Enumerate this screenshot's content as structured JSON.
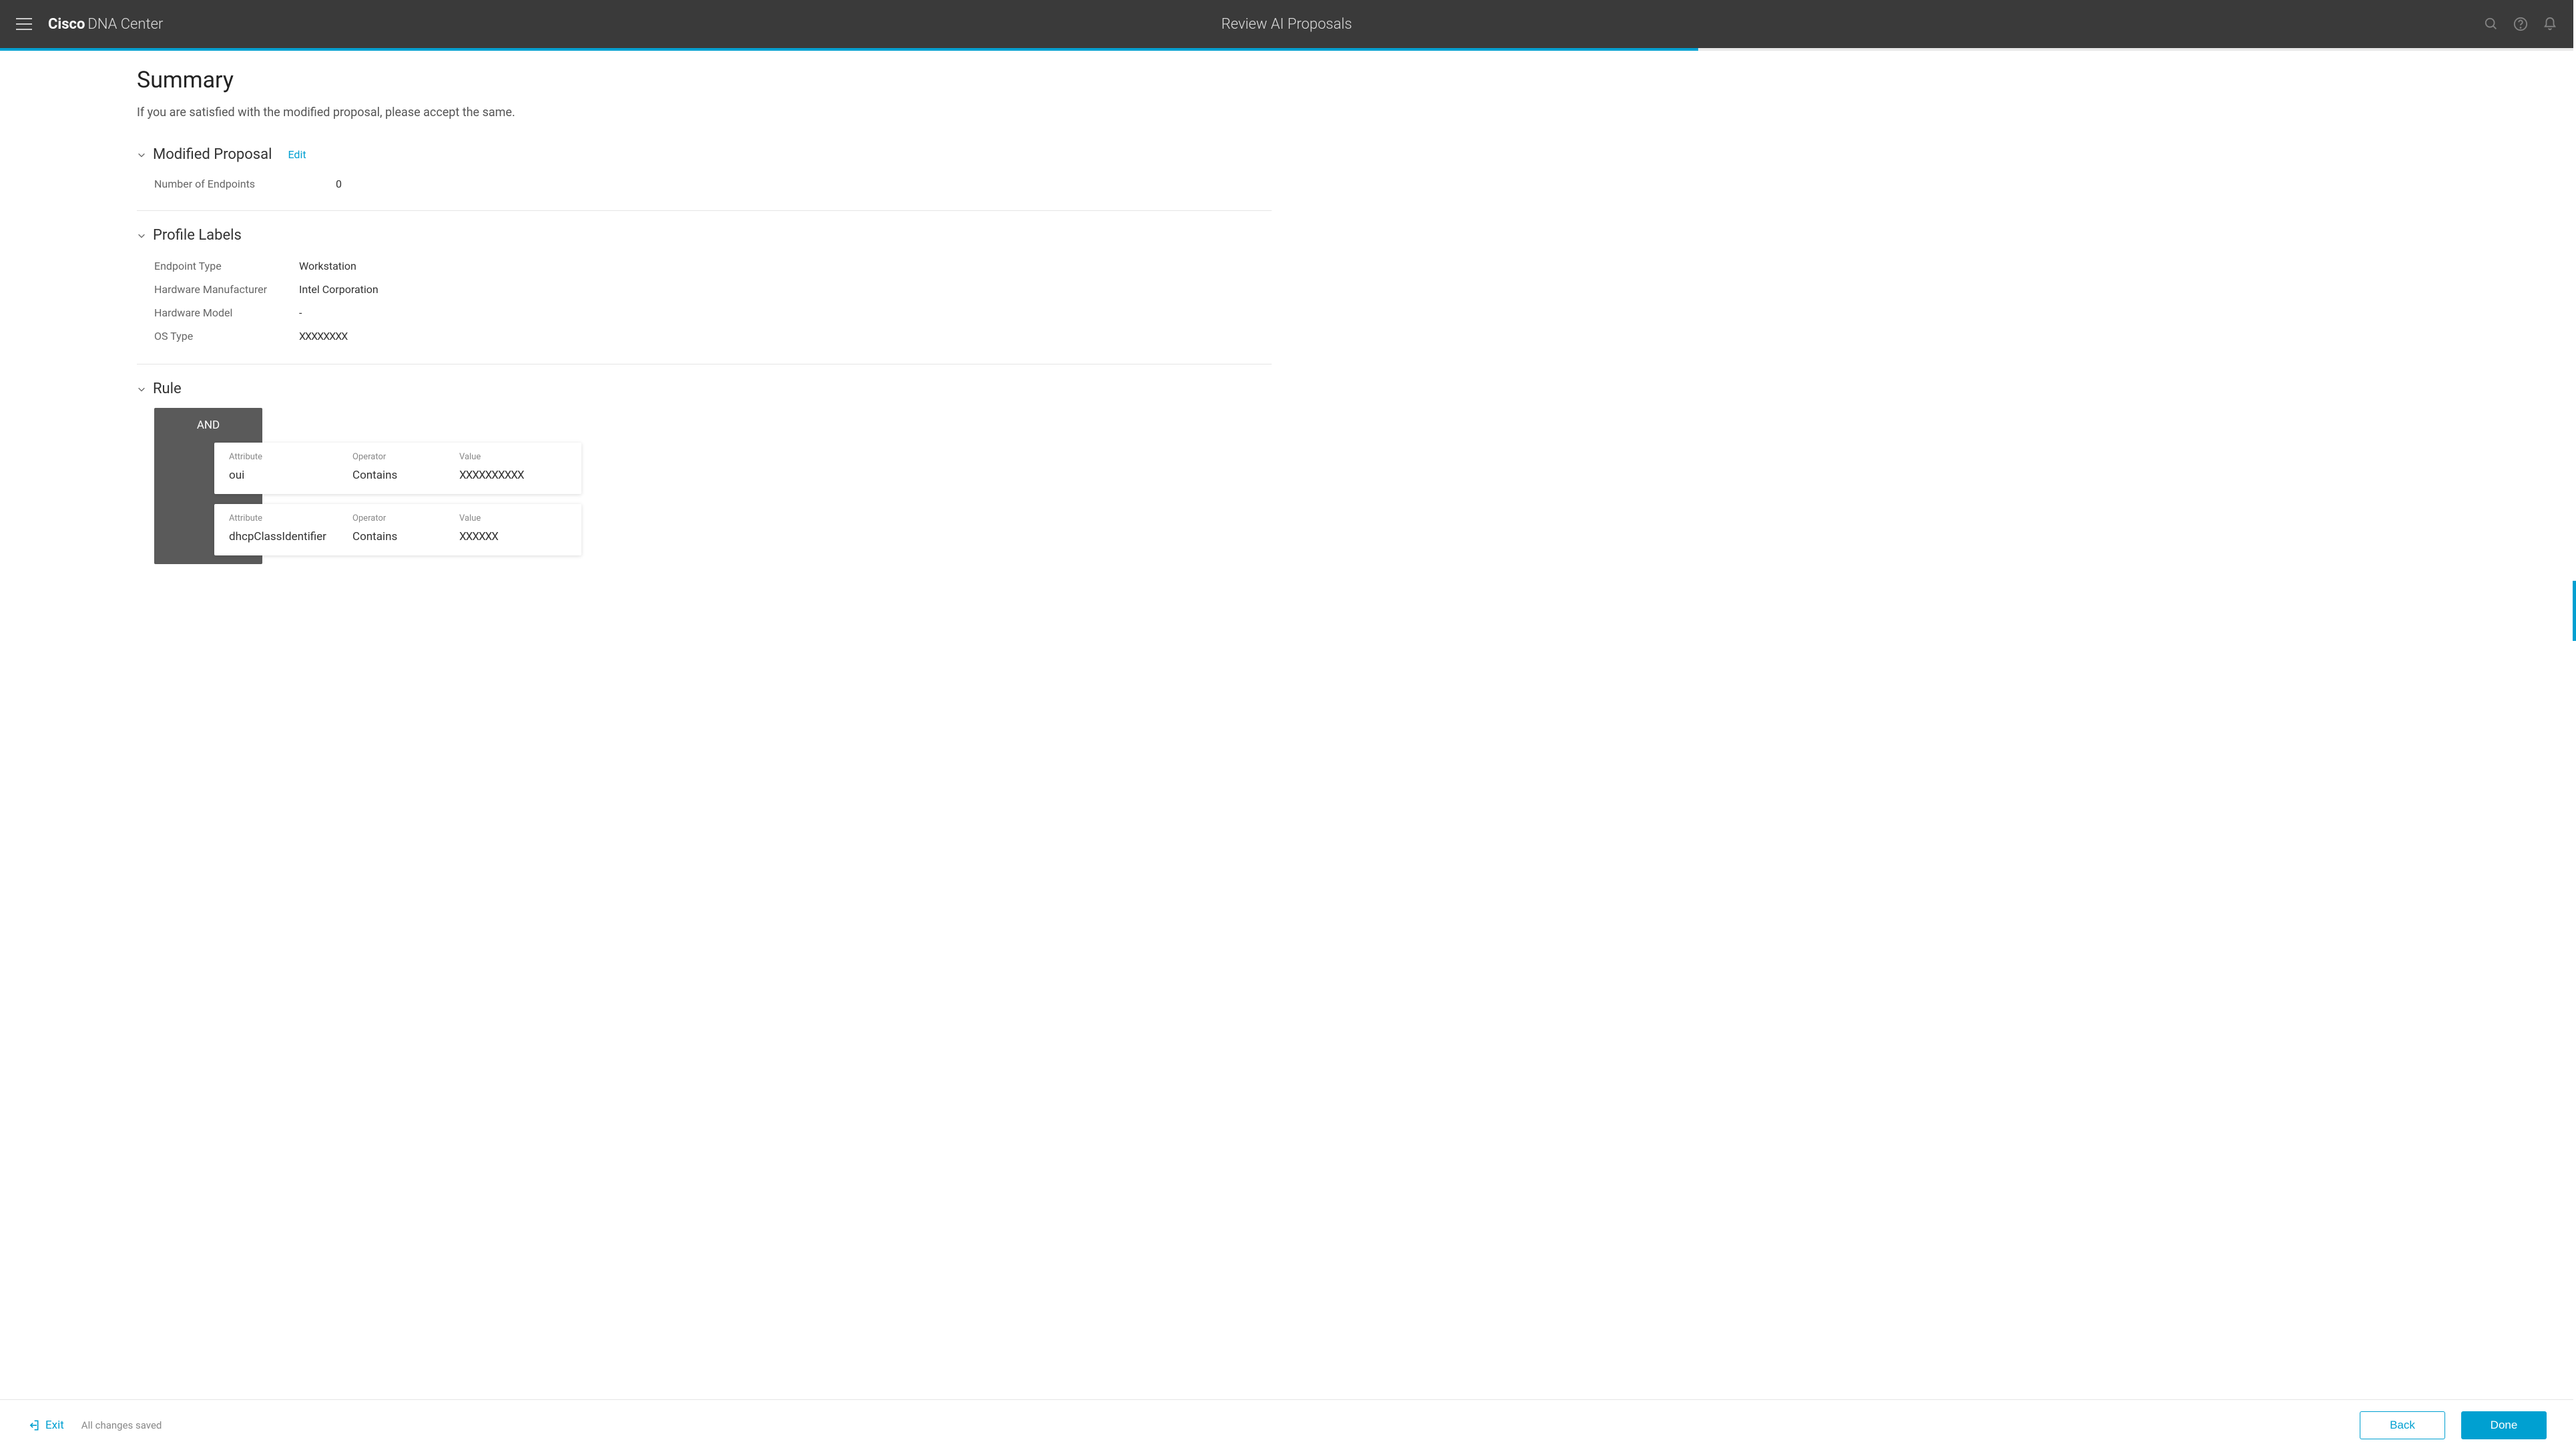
{
  "header": {
    "brand_strong": "Cisco",
    "brand_light": "DNA Center",
    "page_title": "Review AI Proposals"
  },
  "summary": {
    "title": "Summary",
    "subtitle": "If you are satisfied with the modified proposal, please accept the same."
  },
  "modified_proposal": {
    "section_title": "Modified Proposal",
    "edit_label": "Edit",
    "endpoints_label": "Number of Endpoints",
    "endpoints_value": "0"
  },
  "profile_labels": {
    "section_title": "Profile Labels",
    "rows": [
      {
        "label": "Endpoint Type",
        "value": "Workstation"
      },
      {
        "label": "Hardware Manufacturer",
        "value": "Intel Corporation"
      },
      {
        "label": "Hardware Model",
        "value": "-"
      },
      {
        "label": "OS Type",
        "value": "XXXXXXXX"
      }
    ]
  },
  "rule": {
    "section_title": "Rule",
    "operator_block": "AND",
    "headers": {
      "attr": "Attribute",
      "op": "Operator",
      "val": "Value"
    },
    "rows": [
      {
        "attr": "oui",
        "op": "Contains",
        "val": "XXXXXXXXXX"
      },
      {
        "attr": "dhcpClassIdentifier",
        "op": "Contains",
        "val": "XXXXXX"
      }
    ]
  },
  "footer": {
    "exit_label": "Exit",
    "saved_text": "All changes saved",
    "back_label": "Back",
    "done_label": "Done"
  }
}
